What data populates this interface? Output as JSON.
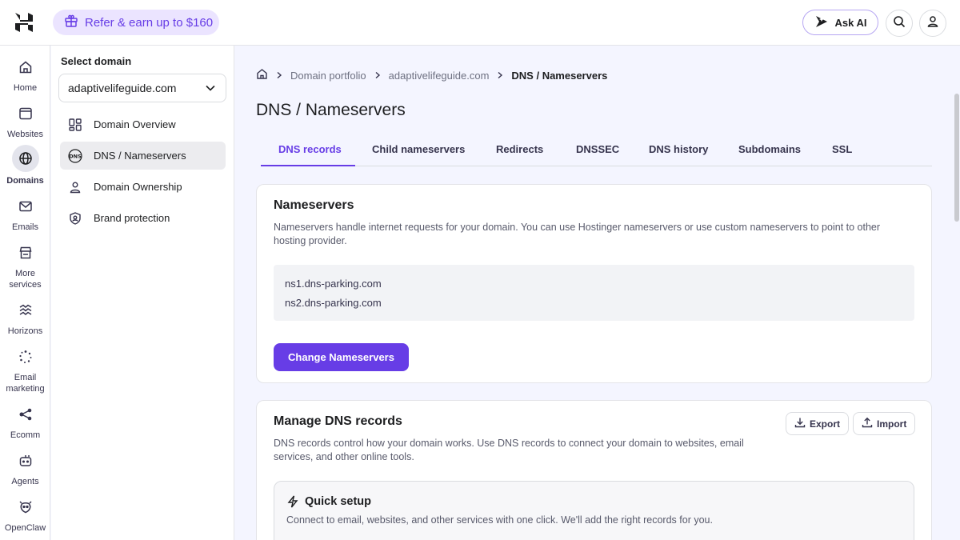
{
  "topbar": {
    "refer_label": "Refer & earn up to $160",
    "askai_label": "Ask AI"
  },
  "rail": [
    {
      "label": "Home",
      "icon": "home-icon"
    },
    {
      "label": "Websites",
      "icon": "browser-icon"
    },
    {
      "label": "Domains",
      "icon": "globe-icon",
      "active": true
    },
    {
      "label": "Emails",
      "icon": "mail-icon"
    },
    {
      "label": "More services",
      "icon": "store-icon"
    },
    {
      "label": "Horizons",
      "icon": "horizons-icon"
    },
    {
      "label": "Email marketing",
      "icon": "sparkle-icon"
    },
    {
      "label": "Ecomm",
      "icon": "share-nodes-icon"
    },
    {
      "label": "Agents",
      "icon": "robot-icon"
    },
    {
      "label": "OpenClaw",
      "icon": "claw-icon"
    }
  ],
  "domain_sidebar": {
    "title": "Select domain",
    "selected_domain": "adaptivelifeguide.com",
    "items": [
      {
        "label": "Domain Overview",
        "icon": "grid-icon"
      },
      {
        "label": "DNS / Nameservers",
        "icon": "dns-icon",
        "active": true
      },
      {
        "label": "Domain Ownership",
        "icon": "person-icon"
      },
      {
        "label": "Brand protection",
        "icon": "shield-icon"
      }
    ]
  },
  "breadcrumb": {
    "items": [
      "Domain portfolio",
      "adaptivelifeguide.com",
      "DNS / Nameservers"
    ]
  },
  "page_title": "DNS / Nameservers",
  "tabs": [
    "DNS records",
    "Child nameservers",
    "Redirects",
    "DNSSEC",
    "DNS history",
    "Subdomains",
    "SSL"
  ],
  "nameservers_card": {
    "title": "Nameservers",
    "description": "Nameservers handle internet requests for your domain. You can use Hostinger nameservers or use custom nameservers to point to other hosting provider.",
    "ns1": "ns1.dns-parking.com",
    "ns2": "ns2.dns-parking.com",
    "button_label": "Change Nameservers"
  },
  "dns_card": {
    "title": "Manage DNS records",
    "description": "DNS records control how your domain works. Use DNS records to connect your domain to websites, email services, and other online tools.",
    "export_label": "Export",
    "import_label": "Import",
    "quick_setup": {
      "title": "Quick setup",
      "description": "Connect to email, websites, and other services with one click. We'll add the right records for you."
    }
  },
  "colors": {
    "accent": "#673de6",
    "refer_bg": "#ebe4ff"
  }
}
